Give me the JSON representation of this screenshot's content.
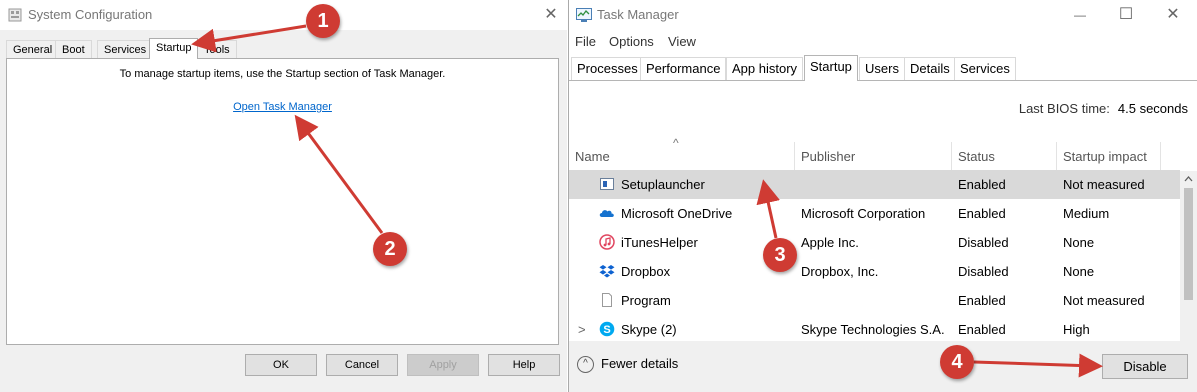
{
  "msconfig": {
    "title": "System Configuration",
    "close_glyph": "✕",
    "tabs": [
      "General",
      "Boot",
      "Services",
      "Startup",
      "Tools"
    ],
    "active_tab": "Startup",
    "message": "To manage startup items, use the Startup section of Task Manager.",
    "link": "Open Task Manager",
    "buttons": {
      "ok": "OK",
      "cancel": "Cancel",
      "apply": "Apply",
      "help": "Help"
    }
  },
  "taskmgr": {
    "title": "Task Manager",
    "controls": {
      "min": "—",
      "max": "☐",
      "close": "✕"
    },
    "menu": [
      "File",
      "Options",
      "View"
    ],
    "tabs": [
      "Processes",
      "Performance",
      "App history",
      "Startup",
      "Users",
      "Details",
      "Services"
    ],
    "active_tab": "Startup",
    "bios_label": "Last BIOS time:",
    "bios_value": "4.5 seconds",
    "sort_glyph": "^",
    "columns": [
      "Name",
      "Publisher",
      "Status",
      "Startup impact"
    ],
    "rows": [
      {
        "name": "Setuplauncher",
        "publisher": "",
        "status": "Enabled",
        "impact": "Not measured",
        "icon": "setup-icon",
        "selected": true
      },
      {
        "name": "Microsoft OneDrive",
        "publisher": "Microsoft Corporation",
        "status": "Enabled",
        "impact": "Medium",
        "icon": "onedrive-icon"
      },
      {
        "name": "iTunesHelper",
        "publisher": "Apple Inc.",
        "status": "Disabled",
        "impact": "None",
        "icon": "itunes-icon"
      },
      {
        "name": "Dropbox",
        "publisher": "Dropbox, Inc.",
        "status": "Disabled",
        "impact": "None",
        "icon": "dropbox-icon"
      },
      {
        "name": "Program",
        "publisher": "",
        "status": "Enabled",
        "impact": "Not measured",
        "icon": "file-icon"
      },
      {
        "name": "Skype (2)",
        "publisher": "Skype Technologies S.A.",
        "status": "Enabled",
        "impact": "High",
        "icon": "skype-icon",
        "expandable": true
      }
    ],
    "expand_glyph": ">",
    "fewer_details": "Fewer details",
    "fewer_glyph": "^",
    "disable_button": "Disable"
  },
  "annotations": [
    "1",
    "2",
    "3",
    "4"
  ],
  "colors": {
    "annotation": "#cf3b33",
    "link": "#0066cc",
    "selected_row": "#d9d9d9"
  }
}
